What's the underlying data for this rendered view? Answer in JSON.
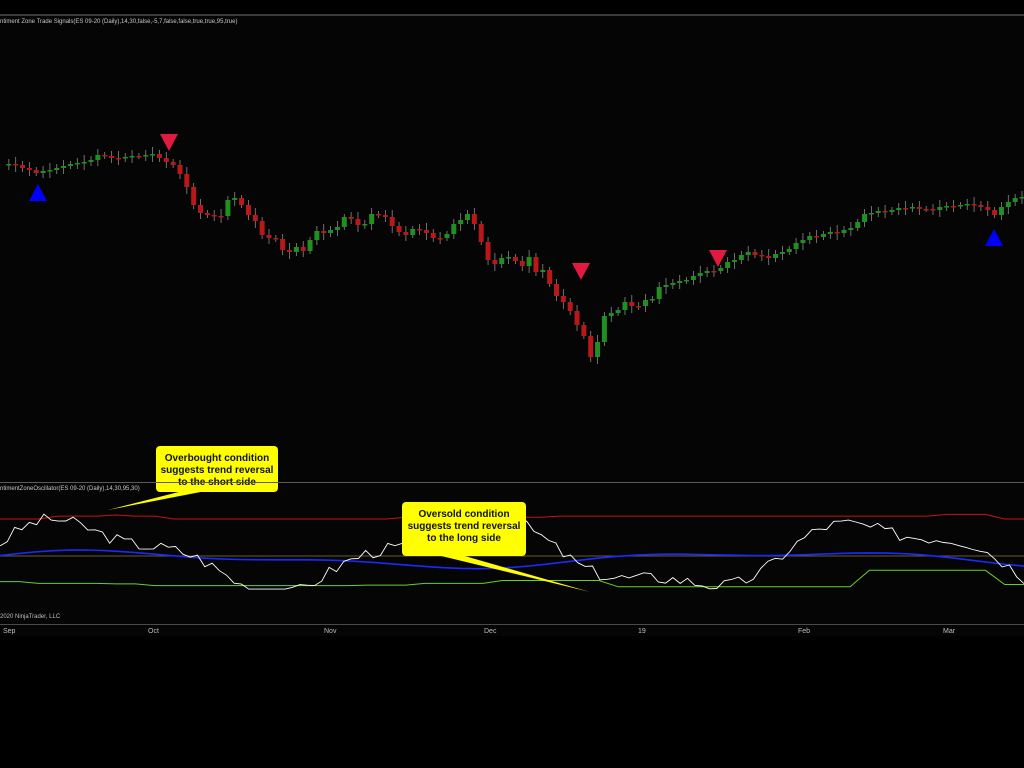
{
  "price_panel": {
    "label": "ntiment Zone Trade Signals(ES 09-20 (Daily),14,30,false,-5,7,false,false,true,true,95,true)"
  },
  "oscillator_panel": {
    "label": "ntimentZoneOscillator(ES 09-20 (Daily),14,30,95,30)"
  },
  "copyright": "2020 NinjaTrader, LLC",
  "time_axis": {
    "ticks": [
      "Sep",
      "Oct",
      "Nov",
      "Dec",
      "19",
      "Feb",
      "Mar"
    ]
  },
  "annotations": {
    "overbought": [
      "Overbought condition",
      "suggests trend reversal",
      "to the short side"
    ],
    "oversold": [
      "Oversold condition",
      "suggests trend reversal",
      "to the long side"
    ]
  },
  "colors": {
    "up_candle": "#1f8f1f",
    "down_candle": "#b81818",
    "buy_signal": "#0000ff",
    "sell_signal": "#e01a40",
    "oscillator": "#ffffff",
    "upper_band": "#c81414",
    "lower_band": "#6ccf2a",
    "signal_line": "#1a2aff",
    "mid_line": "#8a7a3a",
    "callout": "#ffff00"
  },
  "chart_data": {
    "type": "candlestick",
    "candles_close_path": [
      163,
      162,
      163,
      166,
      168,
      171,
      169,
      168,
      166,
      164,
      162,
      161,
      160,
      158,
      153,
      154,
      156,
      156,
      155,
      154,
      154,
      153,
      152,
      156,
      160,
      163,
      172,
      185,
      203,
      211,
      213,
      214,
      214,
      198,
      196,
      203,
      213,
      219,
      233,
      236,
      237,
      248,
      250,
      245,
      249,
      238,
      229,
      231,
      228,
      225,
      215,
      217,
      223,
      222,
      212,
      213,
      215,
      224,
      230,
      233,
      227,
      228,
      231,
      236,
      236,
      232,
      222,
      218,
      212,
      222,
      240,
      258,
      262,
      256,
      255,
      259,
      264,
      255,
      270,
      268,
      282,
      294,
      300,
      309,
      323,
      334,
      355,
      340,
      314,
      311,
      308,
      300,
      304,
      304,
      298,
      297,
      285,
      283,
      281,
      279,
      278,
      274,
      271,
      269,
      269,
      266,
      260,
      258,
      253,
      250,
      253,
      254,
      256,
      252,
      250,
      247,
      241,
      238,
      234,
      235,
      232,
      230,
      231,
      228,
      226,
      220,
      212,
      211,
      209,
      210,
      208,
      206,
      206,
      205,
      207,
      207,
      208,
      205,
      204,
      204,
      203,
      202,
      203,
      205,
      208,
      213,
      205,
      200,
      196,
      195
    ],
    "signals": [
      {
        "type": "buy",
        "x_label": "Sep"
      },
      {
        "type": "sell",
        "x_label": "Oct"
      },
      {
        "type": "sell",
        "x_label": "Dec"
      },
      {
        "type": "sell",
        "x_label": "19"
      },
      {
        "type": "buy",
        "x_label": "Mar"
      }
    ],
    "oscillator": {
      "series": [
        {
          "name": "upper band",
          "values": [
            6.5,
            6.5,
            6.5,
            7,
            7,
            7,
            7.2,
            7,
            7,
            6.5,
            6.5,
            6.5,
            6.5,
            6.5,
            6.5,
            6.5,
            6.5,
            6.5,
            6.5,
            6.5,
            6.5,
            6.8,
            6.8,
            6.8,
            6.8,
            6.8,
            6.8,
            6.8,
            6.8,
            7,
            7,
            7,
            7,
            7,
            7,
            7,
            7,
            7,
            7,
            7,
            7,
            7,
            7,
            7,
            7,
            7,
            7,
            7,
            7,
            7.3,
            7.3,
            7.3,
            6.5,
            6.5
          ]
        },
        {
          "name": "lower band",
          "values": [
            -4.5,
            -4.5,
            -4.8,
            -4.8,
            -4.8,
            -4.8,
            -4.9,
            -4.9,
            -5.2,
            -5.2,
            -5.2,
            -5.2,
            -5.2,
            -5.2,
            -5.2,
            -5.2,
            -5.2,
            -5.2,
            -5.2,
            -5.1,
            -5.1,
            -5.1,
            -4.8,
            -4.8,
            -4.8,
            -4.8,
            -4.3,
            -4.3,
            -4.3,
            -4.3,
            -4.3,
            -4.3,
            -5.4,
            -5.4,
            -5.4,
            -5.4,
            -5.4,
            -5.4,
            -5.4,
            -5.4,
            -5.4,
            -5.4,
            -5.4,
            -5.4,
            -5.4,
            -2.5,
            -2.5,
            -2.5,
            -2.5,
            -2.5,
            -2.5,
            -2.5,
            -5,
            -5
          ]
        }
      ]
    }
  }
}
